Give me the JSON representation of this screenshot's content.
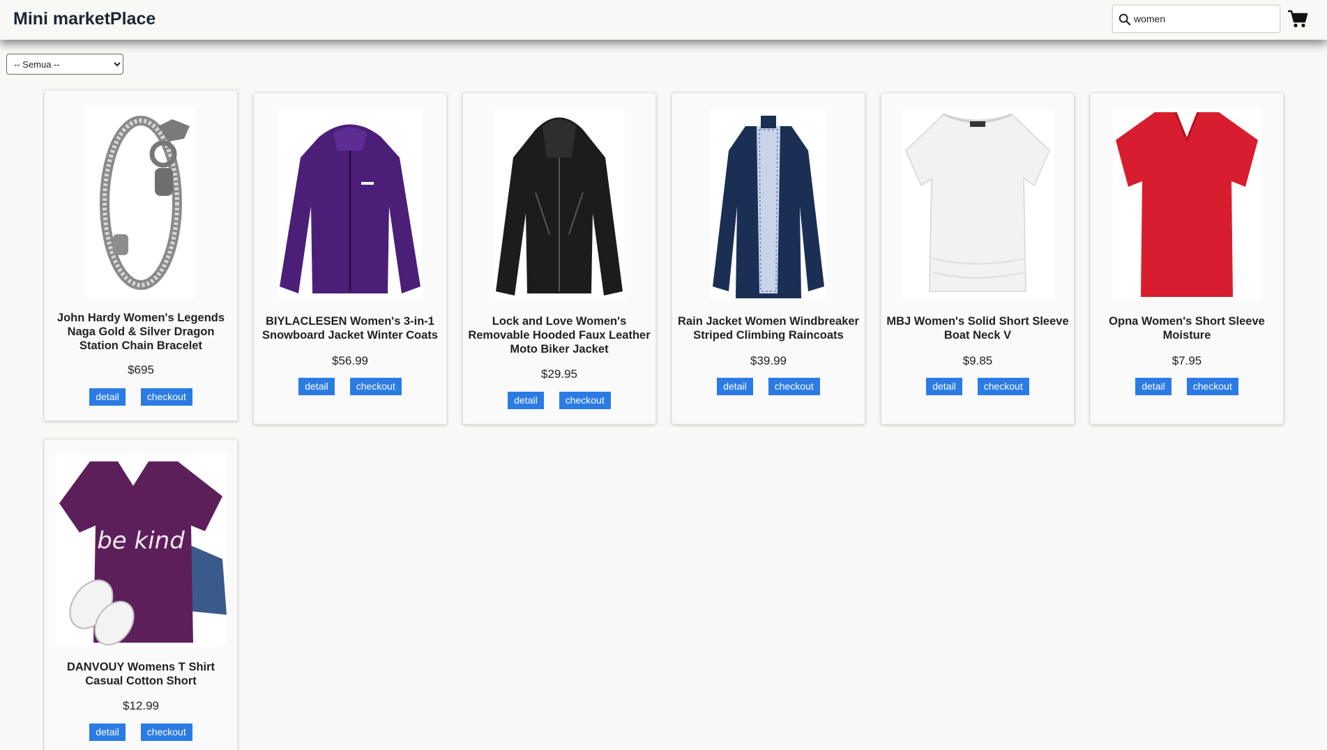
{
  "header": {
    "brand": "Mini marketPlace",
    "search": {
      "value": "women",
      "icon": "search-icon"
    },
    "cart_icon": "shopping-cart-icon"
  },
  "filter": {
    "selected": "-- Semua --"
  },
  "buttons": {
    "detail": "detail",
    "checkout": "checkout",
    "color": "#2b7be5"
  },
  "products": [
    {
      "title": "John Hardy Women's Legends Naga Gold & Silver Dragon Station Chain Bracelet",
      "price": "$695"
    },
    {
      "title": "BIYLACLESEN Women's 3-in-1 Snowboard Jacket Winter Coats",
      "price": "$56.99"
    },
    {
      "title": "Lock and Love Women's Removable Hooded Faux Leather Moto Biker Jacket",
      "price": "$29.95"
    },
    {
      "title": "Rain Jacket Women Windbreaker Striped Climbing Raincoats",
      "price": "$39.99"
    },
    {
      "title": "MBJ Women's Solid Short Sleeve Boat Neck V",
      "price": "$9.85"
    },
    {
      "title": "Opna Women's Short Sleeve Moisture",
      "price": "$7.95"
    },
    {
      "title": "DANVOUY Womens T Shirt Casual Cotton Short",
      "price": "$12.99",
      "image_text": "be kind"
    }
  ]
}
